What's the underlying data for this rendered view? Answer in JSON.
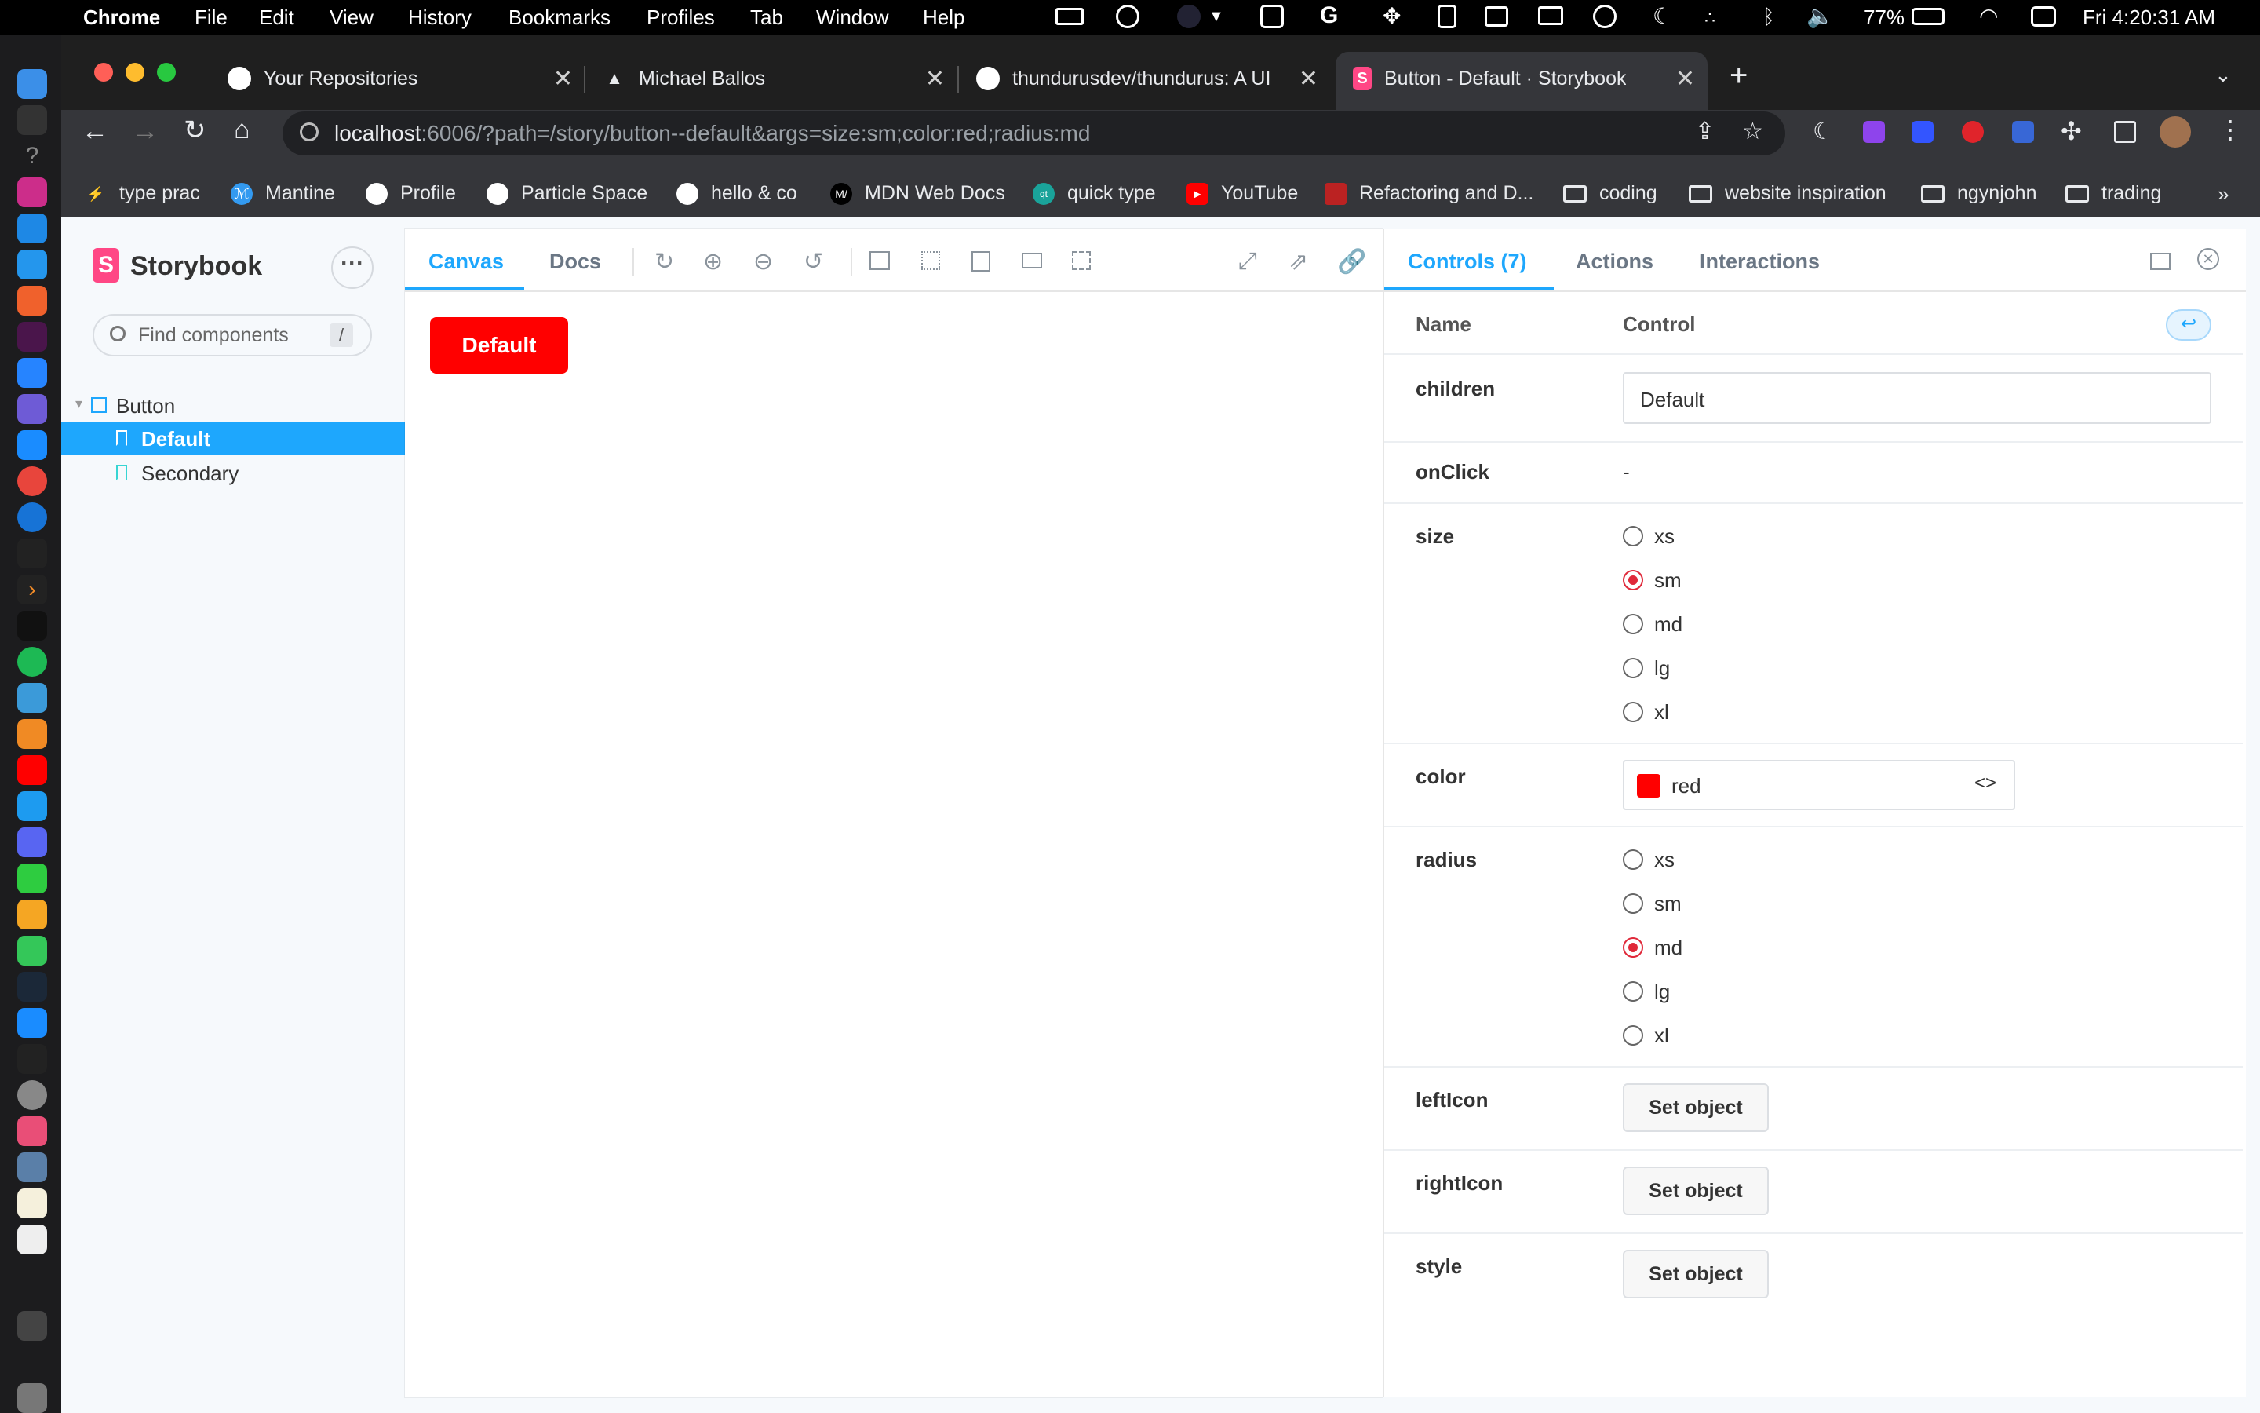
{
  "menubar": {
    "app": "Chrome",
    "items": [
      "File",
      "Edit",
      "View",
      "History",
      "Bookmarks",
      "Profiles",
      "Tab",
      "Window",
      "Help"
    ],
    "battery": "77%",
    "clock": "Fri  4:20:31 AM"
  },
  "tabs": [
    {
      "title": "Your Repositories",
      "icon": "github-icon"
    },
    {
      "title": "Michael Ballos",
      "icon": "triangle-icon"
    },
    {
      "title": "thundurusdev/thundurus: A UI",
      "icon": "github-icon"
    },
    {
      "title": "Button - Default · Storybook",
      "icon": "storybook-icon",
      "active": true
    }
  ],
  "address": {
    "host": "localhost",
    "rest": ":6006/?path=/story/button--default&args=size:sm;color:red;radius:md"
  },
  "bookmarks": [
    {
      "label": "type prac",
      "icon": "bolt-icon"
    },
    {
      "label": "Mantine",
      "icon": "mantine-icon"
    },
    {
      "label": "Profile",
      "icon": "github-icon"
    },
    {
      "label": "Particle Space",
      "icon": "github-icon"
    },
    {
      "label": "hello & co",
      "icon": "github-icon"
    },
    {
      "label": "MDN Web Docs",
      "icon": "mdn-icon"
    },
    {
      "label": "quick type",
      "icon": "qt-icon"
    },
    {
      "label": "YouTube",
      "icon": "youtube-icon"
    },
    {
      "label": "Refactoring and D...",
      "icon": "refactoring-icon"
    },
    {
      "label": "coding",
      "icon": "folder-icon"
    },
    {
      "label": "website inspiration",
      "icon": "folder-icon"
    },
    {
      "label": "ngynjohn",
      "icon": "folder-icon"
    },
    {
      "label": "trading",
      "icon": "folder-icon"
    }
  ],
  "sidebar": {
    "brand": "Storybook",
    "search_placeholder": "Find components",
    "search_shortcut": "/",
    "tree": {
      "group": "Button",
      "stories": [
        "Default",
        "Secondary"
      ]
    }
  },
  "preview": {
    "tabs": [
      "Canvas",
      "Docs"
    ],
    "button_label": "Default",
    "button_color": "#ff0000"
  },
  "addons": {
    "tabs": [
      "Controls (7)",
      "Actions",
      "Interactions"
    ],
    "header_name": "Name",
    "header_control": "Control",
    "rows": {
      "children": {
        "name": "children",
        "value": "Default"
      },
      "onClick": {
        "name": "onClick",
        "value": "-"
      },
      "size": {
        "name": "size",
        "options": [
          "xs",
          "sm",
          "md",
          "lg",
          "xl"
        ],
        "selected": "sm"
      },
      "color": {
        "name": "color",
        "value": "red",
        "swatch": "#ff0000"
      },
      "radius": {
        "name": "radius",
        "options": [
          "xs",
          "sm",
          "md",
          "lg",
          "xl"
        ],
        "selected": "md"
      },
      "leftIcon": {
        "name": "leftIcon",
        "button": "Set object"
      },
      "rightIcon": {
        "name": "rightIcon",
        "button": "Set object"
      },
      "style": {
        "name": "style",
        "button": "Set object"
      }
    }
  },
  "colors": {
    "accent": "#1ea7fd",
    "brand": "#ff4785",
    "radio": "#e0293a"
  }
}
